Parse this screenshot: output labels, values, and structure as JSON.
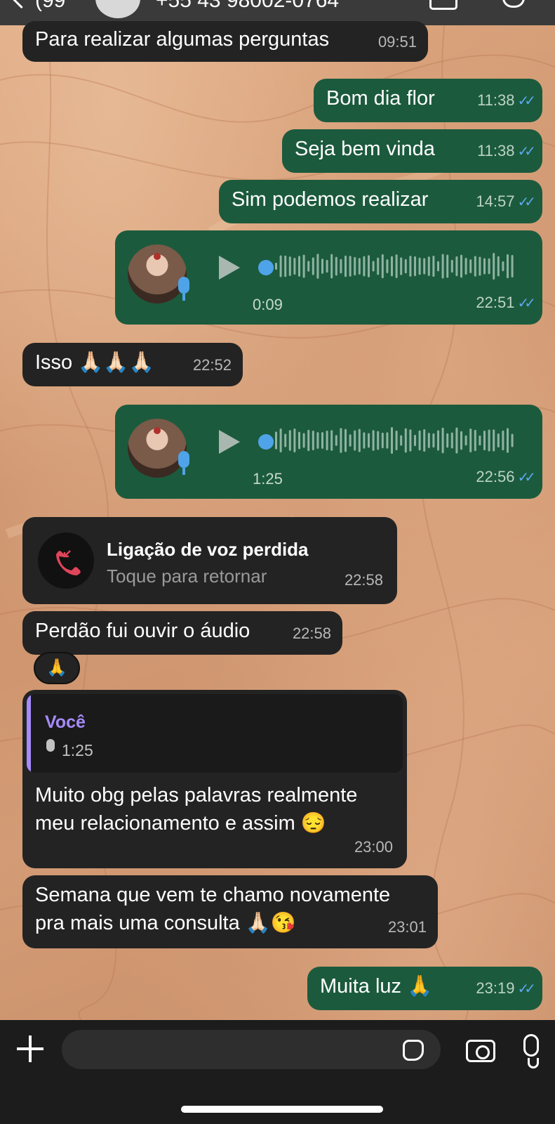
{
  "header": {
    "back_count": "(99",
    "contact": "+55 43 98002-0764"
  },
  "messages": [
    {
      "dir": "in",
      "type": "text",
      "text": "Para realizar algumas perguntas",
      "time": "09:51"
    },
    {
      "dir": "out",
      "type": "text",
      "text": "Bom dia flor",
      "time": "11:38"
    },
    {
      "dir": "out",
      "type": "text",
      "text": "Seja bem vinda",
      "time": "11:38"
    },
    {
      "dir": "out",
      "type": "text",
      "text": "Sim podemos realizar",
      "time": "14:57"
    },
    {
      "dir": "out",
      "type": "voice",
      "duration": "0:09",
      "time": "22:51",
      "progress": 0.0
    },
    {
      "dir": "in",
      "type": "text",
      "text": "Isso 🙏🏻🙏🏻🙏🏻",
      "time": "22:52"
    },
    {
      "dir": "out",
      "type": "voice",
      "duration": "1:25",
      "time": "22:56",
      "progress": 0.0
    },
    {
      "dir": "in",
      "type": "call",
      "title": "Ligação de voz perdida",
      "subtitle": "Toque para retornar",
      "time": "22:58"
    },
    {
      "dir": "in",
      "type": "text",
      "text": "Perdão fui ouvir o áudio",
      "time": "22:58",
      "reaction": "🙏"
    },
    {
      "dir": "in",
      "type": "reply",
      "quote_author": "Você",
      "quote_duration": "1:25",
      "text_line1": "Muito obg pelas palavras realmente",
      "text_line2": "meu relacionamento  e assim 😔",
      "time": "23:00"
    },
    {
      "dir": "in",
      "type": "text2",
      "text_line1": "Semana que vem te chamo novamente",
      "text_line2": "pra mais uma consulta 🙏🏻😘",
      "time": "23:01"
    },
    {
      "dir": "out",
      "type": "text",
      "text": "Muita luz 🙏",
      "time": "23:19"
    }
  ],
  "ticks": "✓✓",
  "colors": {
    "incoming": "#232323",
    "outgoing": "#1c5a3d",
    "accent": "#4fa3e8",
    "quote_author": "#a78bfa"
  },
  "icons": [
    "plus-icon",
    "sticker-icon",
    "camera-icon",
    "mic-icon",
    "play-icon",
    "missed-call-icon"
  ]
}
